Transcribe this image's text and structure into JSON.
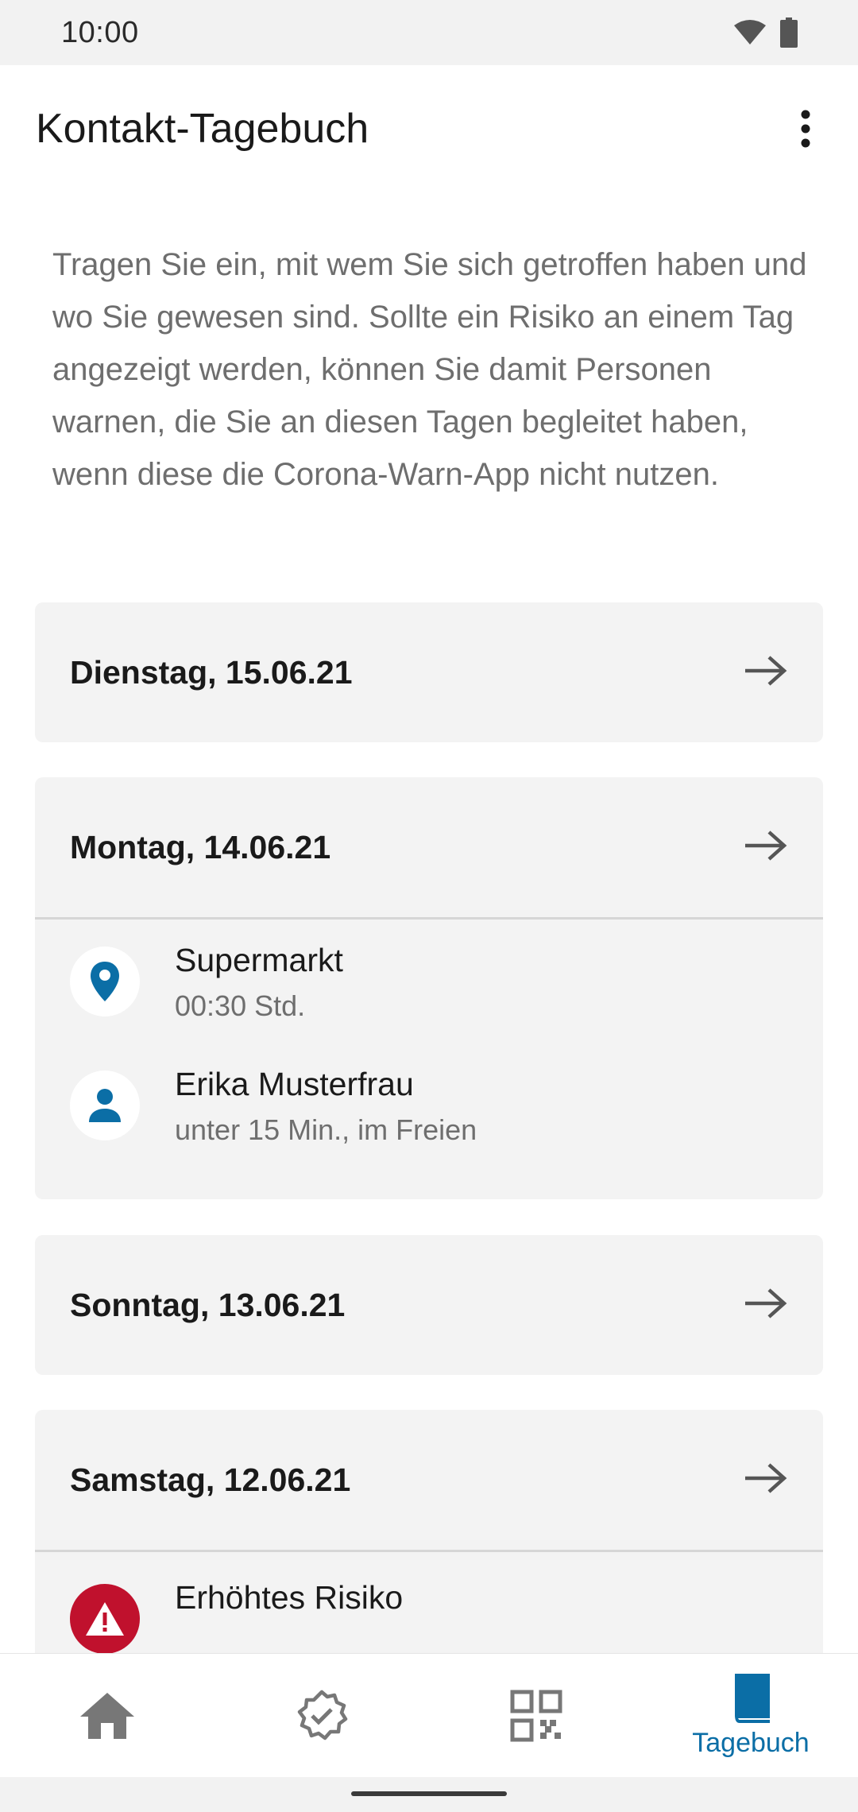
{
  "status_bar": {
    "time": "10:00"
  },
  "app_bar": {
    "title": "Kontakt-Tagebuch"
  },
  "intro_text": "Tragen Sie ein, mit wem Sie sich getroffen haben und wo Sie gewesen sind. Sollte ein Risiko an einem Tag angezeigt werden, können Sie damit Personen warnen, die Sie an diesen Tagen begleitet haben, wenn diese die Corona-Warn-App nicht nutzen.",
  "days": [
    {
      "date": "Dienstag, 15.06.21",
      "entries": []
    },
    {
      "date": "Montag, 14.06.21",
      "entries": [
        {
          "icon": "location-pin-icon",
          "name": "Supermarkt",
          "detail": "00:30 Std."
        },
        {
          "icon": "person-icon",
          "name": "Erika Musterfrau",
          "detail": "unter 15 Min., im Freien"
        }
      ]
    },
    {
      "date": "Sonntag, 13.06.21",
      "entries": []
    },
    {
      "date": "Samstag, 12.06.21",
      "entries": [
        {
          "icon": "warning-icon",
          "name": "Erhöhtes Risiko"
        }
      ]
    }
  ],
  "bottom_nav": {
    "items": [
      {
        "icon": "home-icon",
        "label": ""
      },
      {
        "icon": "certificate-check-icon",
        "label": ""
      },
      {
        "icon": "qr-code-icon",
        "label": ""
      },
      {
        "icon": "book-icon",
        "label": "Tagebuch",
        "active": true
      }
    ]
  },
  "colors": {
    "accent": "#0b6ea6",
    "risk": "#c0112d",
    "card_bg": "#f3f3f3",
    "muted_text": "#6e6e6e"
  }
}
